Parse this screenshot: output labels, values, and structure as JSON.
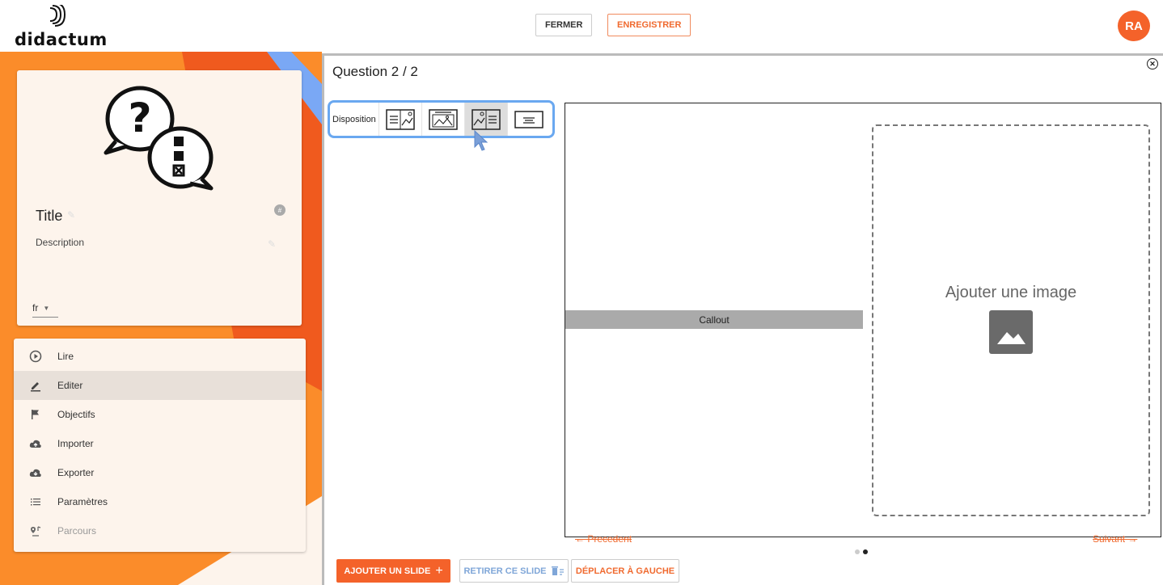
{
  "header": {
    "logo_text": "didactum",
    "close_label": "FERMER",
    "save_label": "ENREGISTRER",
    "avatar_initials": "RA"
  },
  "sidebar": {
    "card": {
      "title": "Title",
      "description_placeholder": "Description",
      "language": "fr",
      "hash_badge": "#"
    },
    "menu": [
      {
        "label": "Lire",
        "icon": "play-circle-icon"
      },
      {
        "label": "Editer",
        "icon": "pencil-icon",
        "active": true
      },
      {
        "label": "Objectifs",
        "icon": "flag-icon"
      },
      {
        "label": "Importer",
        "icon": "cloud-upload-icon"
      },
      {
        "label": "Exporter",
        "icon": "cloud-download-icon"
      },
      {
        "label": "Paramètres",
        "icon": "list-icon"
      },
      {
        "label": "Parcours",
        "icon": "route-pin-icon",
        "disabled": true
      }
    ]
  },
  "editor": {
    "question_title": "Question 2 / 2",
    "disposition_label": "Disposition",
    "layout_options": [
      "text-left-image-right",
      "image-only",
      "image-left-text-right",
      "text-only"
    ],
    "selected_layout": 2,
    "callout_label": "Callout",
    "add_image_label": "Ajouter une image",
    "prev_label": "← Precedent",
    "next_label": "Suivant →",
    "slide_count": 2,
    "current_slide": 2,
    "add_slide_label": "AJOUTER UN SLIDE",
    "remove_slide_label": "RETIRER CE SLIDE",
    "move_left_label": "DÉPLACER À GAUCHE"
  },
  "colors": {
    "accent": "#f4622a",
    "sidebar_bg": "#fb8c2a",
    "highlight_border": "#6aa8f0"
  }
}
